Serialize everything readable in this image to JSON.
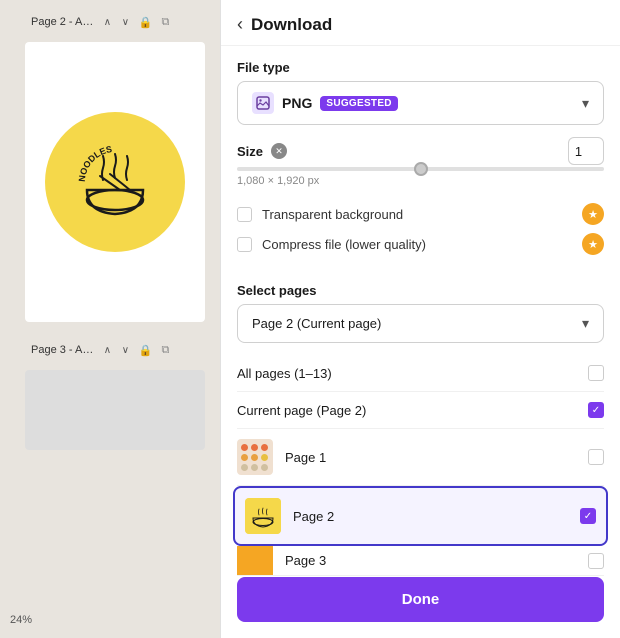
{
  "header": {
    "back_label": "‹",
    "title": "Download"
  },
  "file_type": {
    "label": "File type",
    "selected": "PNG",
    "badge": "SUGGESTED",
    "icon_label": "img-icon"
  },
  "size": {
    "label": "Size",
    "value": "1",
    "dimensions": "1,080 × 1,920 px"
  },
  "options": {
    "transparent_bg": "Transparent background",
    "compress": "Compress file (lower quality)"
  },
  "select_pages": {
    "label": "Select pages",
    "dropdown_value": "Page 2 (Current page)"
  },
  "pages": [
    {
      "id": "all",
      "label": "All pages (1–13)",
      "checked": false,
      "has_thumb": false
    },
    {
      "id": "current",
      "label": "Current page (Page 2)",
      "checked": true,
      "has_thumb": false
    },
    {
      "id": "page1",
      "label": "Page 1",
      "checked": false,
      "has_thumb": true,
      "thumb_type": "dots"
    },
    {
      "id": "page2",
      "label": "Page 2",
      "checked": true,
      "has_thumb": true,
      "thumb_type": "noodles",
      "selected": true
    },
    {
      "id": "page3",
      "label": "Page 3",
      "checked": false,
      "has_thumb": true,
      "thumb_type": "orange"
    }
  ],
  "done_button": "Done",
  "canvas": {
    "page2_label": "Page 2 - A…",
    "page3_label": "Page 3 - A…",
    "zoom": "24%"
  }
}
